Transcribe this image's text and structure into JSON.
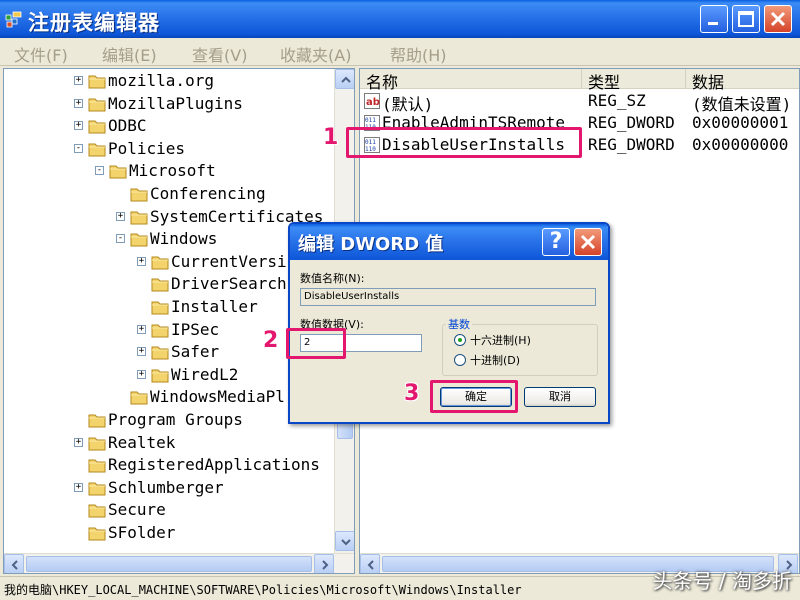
{
  "window": {
    "title": "注册表编辑器"
  },
  "menu": [
    "文件(F)",
    "编辑(E)",
    "查看(V)",
    "收藏夹(A)",
    "帮助(H)"
  ],
  "tree": [
    {
      "label": "mozilla.org",
      "depth": 0,
      "expander": "+"
    },
    {
      "label": "MozillaPlugins",
      "depth": 0,
      "expander": "+"
    },
    {
      "label": "ODBC",
      "depth": 0,
      "expander": "+"
    },
    {
      "label": "Policies",
      "depth": 0,
      "expander": "-"
    },
    {
      "label": "Microsoft",
      "depth": 1,
      "expander": "-"
    },
    {
      "label": "Conferencing",
      "depth": 2,
      "expander": ""
    },
    {
      "label": "SystemCertificates",
      "depth": 2,
      "expander": "+"
    },
    {
      "label": "Windows",
      "depth": 2,
      "expander": "-"
    },
    {
      "label": "CurrentVersi",
      "depth": 3,
      "expander": "+"
    },
    {
      "label": "DriverSearch",
      "depth": 3,
      "expander": ""
    },
    {
      "label": "Installer",
      "depth": 3,
      "expander": ""
    },
    {
      "label": "IPSec",
      "depth": 3,
      "expander": "+"
    },
    {
      "label": "Safer",
      "depth": 3,
      "expander": "+"
    },
    {
      "label": "WiredL2",
      "depth": 3,
      "expander": "+"
    },
    {
      "label": "WindowsMediaPl",
      "depth": 2,
      "expander": ""
    },
    {
      "label": "Program Groups",
      "depth": 0,
      "expander": ""
    },
    {
      "label": "Realtek",
      "depth": 0,
      "expander": "+"
    },
    {
      "label": "RegisteredApplications",
      "depth": 0,
      "expander": ""
    },
    {
      "label": "Schlumberger",
      "depth": 0,
      "expander": "+"
    },
    {
      "label": "Secure",
      "depth": 0,
      "expander": ""
    },
    {
      "label": "SFolder",
      "depth": 0,
      "expander": ""
    }
  ],
  "list": {
    "columns": [
      "名称",
      "类型",
      "数据"
    ],
    "rows": [
      {
        "name": "(默认)",
        "type": "REG_SZ",
        "data": "(数值未设置)",
        "icon": "string-value-icon"
      },
      {
        "name": "EnableAdminTSRemote",
        "type": "REG_DWORD",
        "data": "0x00000001",
        "icon": "dword-value-icon"
      },
      {
        "name": "DisableUserInstalls",
        "type": "REG_DWORD",
        "data": "0x00000000",
        "icon": "dword-value-icon"
      }
    ]
  },
  "status": {
    "path": "我的电脑\\HKEY_LOCAL_MACHINE\\SOFTWARE\\Policies\\Microsoft\\Windows\\Installer"
  },
  "watermark": "头条号 / 淘多折",
  "dialog": {
    "title": "编辑 DWORD 值",
    "value_name_label": "数值名称(N):",
    "value_name": "DisableUserInstalls",
    "value_data_label": "数值数据(V):",
    "value_data": "2",
    "base_label": "基数",
    "hex_label": "十六进制(H)",
    "dec_label": "十进制(D)",
    "selected_base": "hex",
    "ok_label": "确定",
    "cancel_label": "取消"
  },
  "annotations": [
    "1",
    "2",
    "3"
  ],
  "colors": {
    "titlebar": "#2A74EA",
    "annotation": "#E3176E",
    "pane_bg": "#FFFFFF",
    "chrome": "#ECE9D8"
  }
}
